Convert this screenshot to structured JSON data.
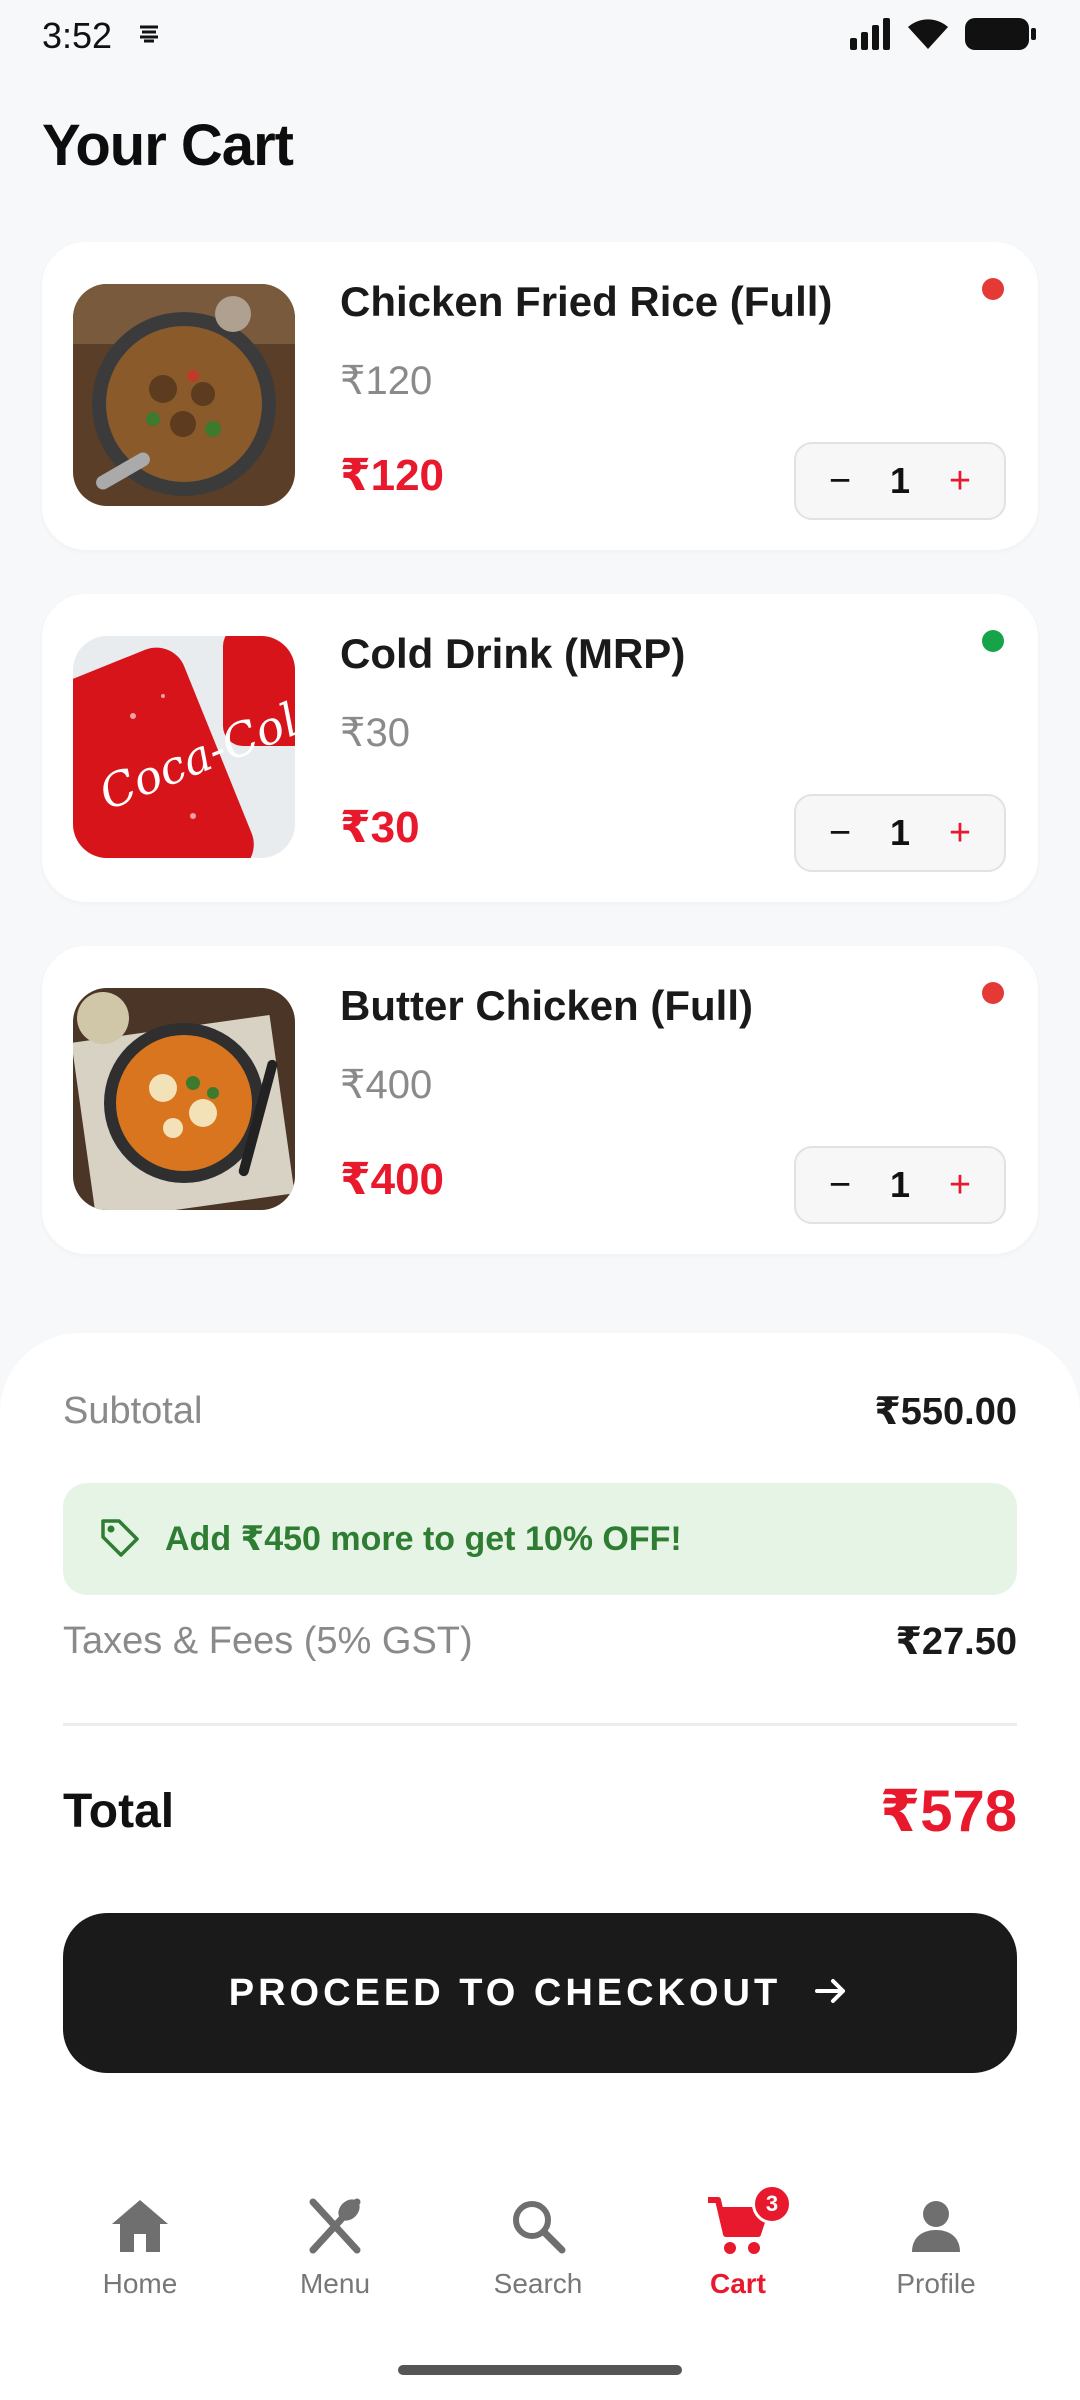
{
  "status_bar": {
    "time": "3:52",
    "note_icon": "notification-icon"
  },
  "page": {
    "title": "Your Cart"
  },
  "cart": {
    "items": [
      {
        "name": "Chicken Fried Rice (Full)",
        "unit_price": "₹120",
        "total": "₹120",
        "quantity": "1",
        "dot_color": "#e53935",
        "image": "fried-rice-photo"
      },
      {
        "name": "Cold Drink (MRP)",
        "unit_price": "₹30",
        "total": "₹30",
        "quantity": "1",
        "dot_color": "#16a34a",
        "image": "coca-cola-can-photo"
      },
      {
        "name": "Butter Chicken (Full)",
        "unit_price": "₹400",
        "total": "₹400",
        "quantity": "1",
        "dot_color": "#e53935",
        "image": "butter-chicken-photo"
      }
    ],
    "minus_symbol": "−",
    "plus_symbol": "+"
  },
  "summary": {
    "subtotal_label": "Subtotal",
    "subtotal_value": "₹550.00",
    "promo_text": "Add ₹450 more to get 10% OFF!",
    "taxes_label": "Taxes & Fees (5% GST)",
    "taxes_value": "₹27.50",
    "total_label": "Total",
    "total_value": "₹578",
    "checkout_label": "PROCEED TO CHECKOUT"
  },
  "nav": {
    "items": [
      {
        "label": "Home",
        "icon": "home-icon"
      },
      {
        "label": "Menu",
        "icon": "utensils-icon"
      },
      {
        "label": "Search",
        "icon": "search-icon"
      },
      {
        "label": "Cart",
        "icon": "cart-icon",
        "active": true,
        "badge": "3"
      },
      {
        "label": "Profile",
        "icon": "person-icon"
      }
    ]
  },
  "colors": {
    "accent": "#e8192c",
    "promo_green": "#2e7d32",
    "promo_bg": "#e6f4e6",
    "dark": "#1a1a1a"
  }
}
